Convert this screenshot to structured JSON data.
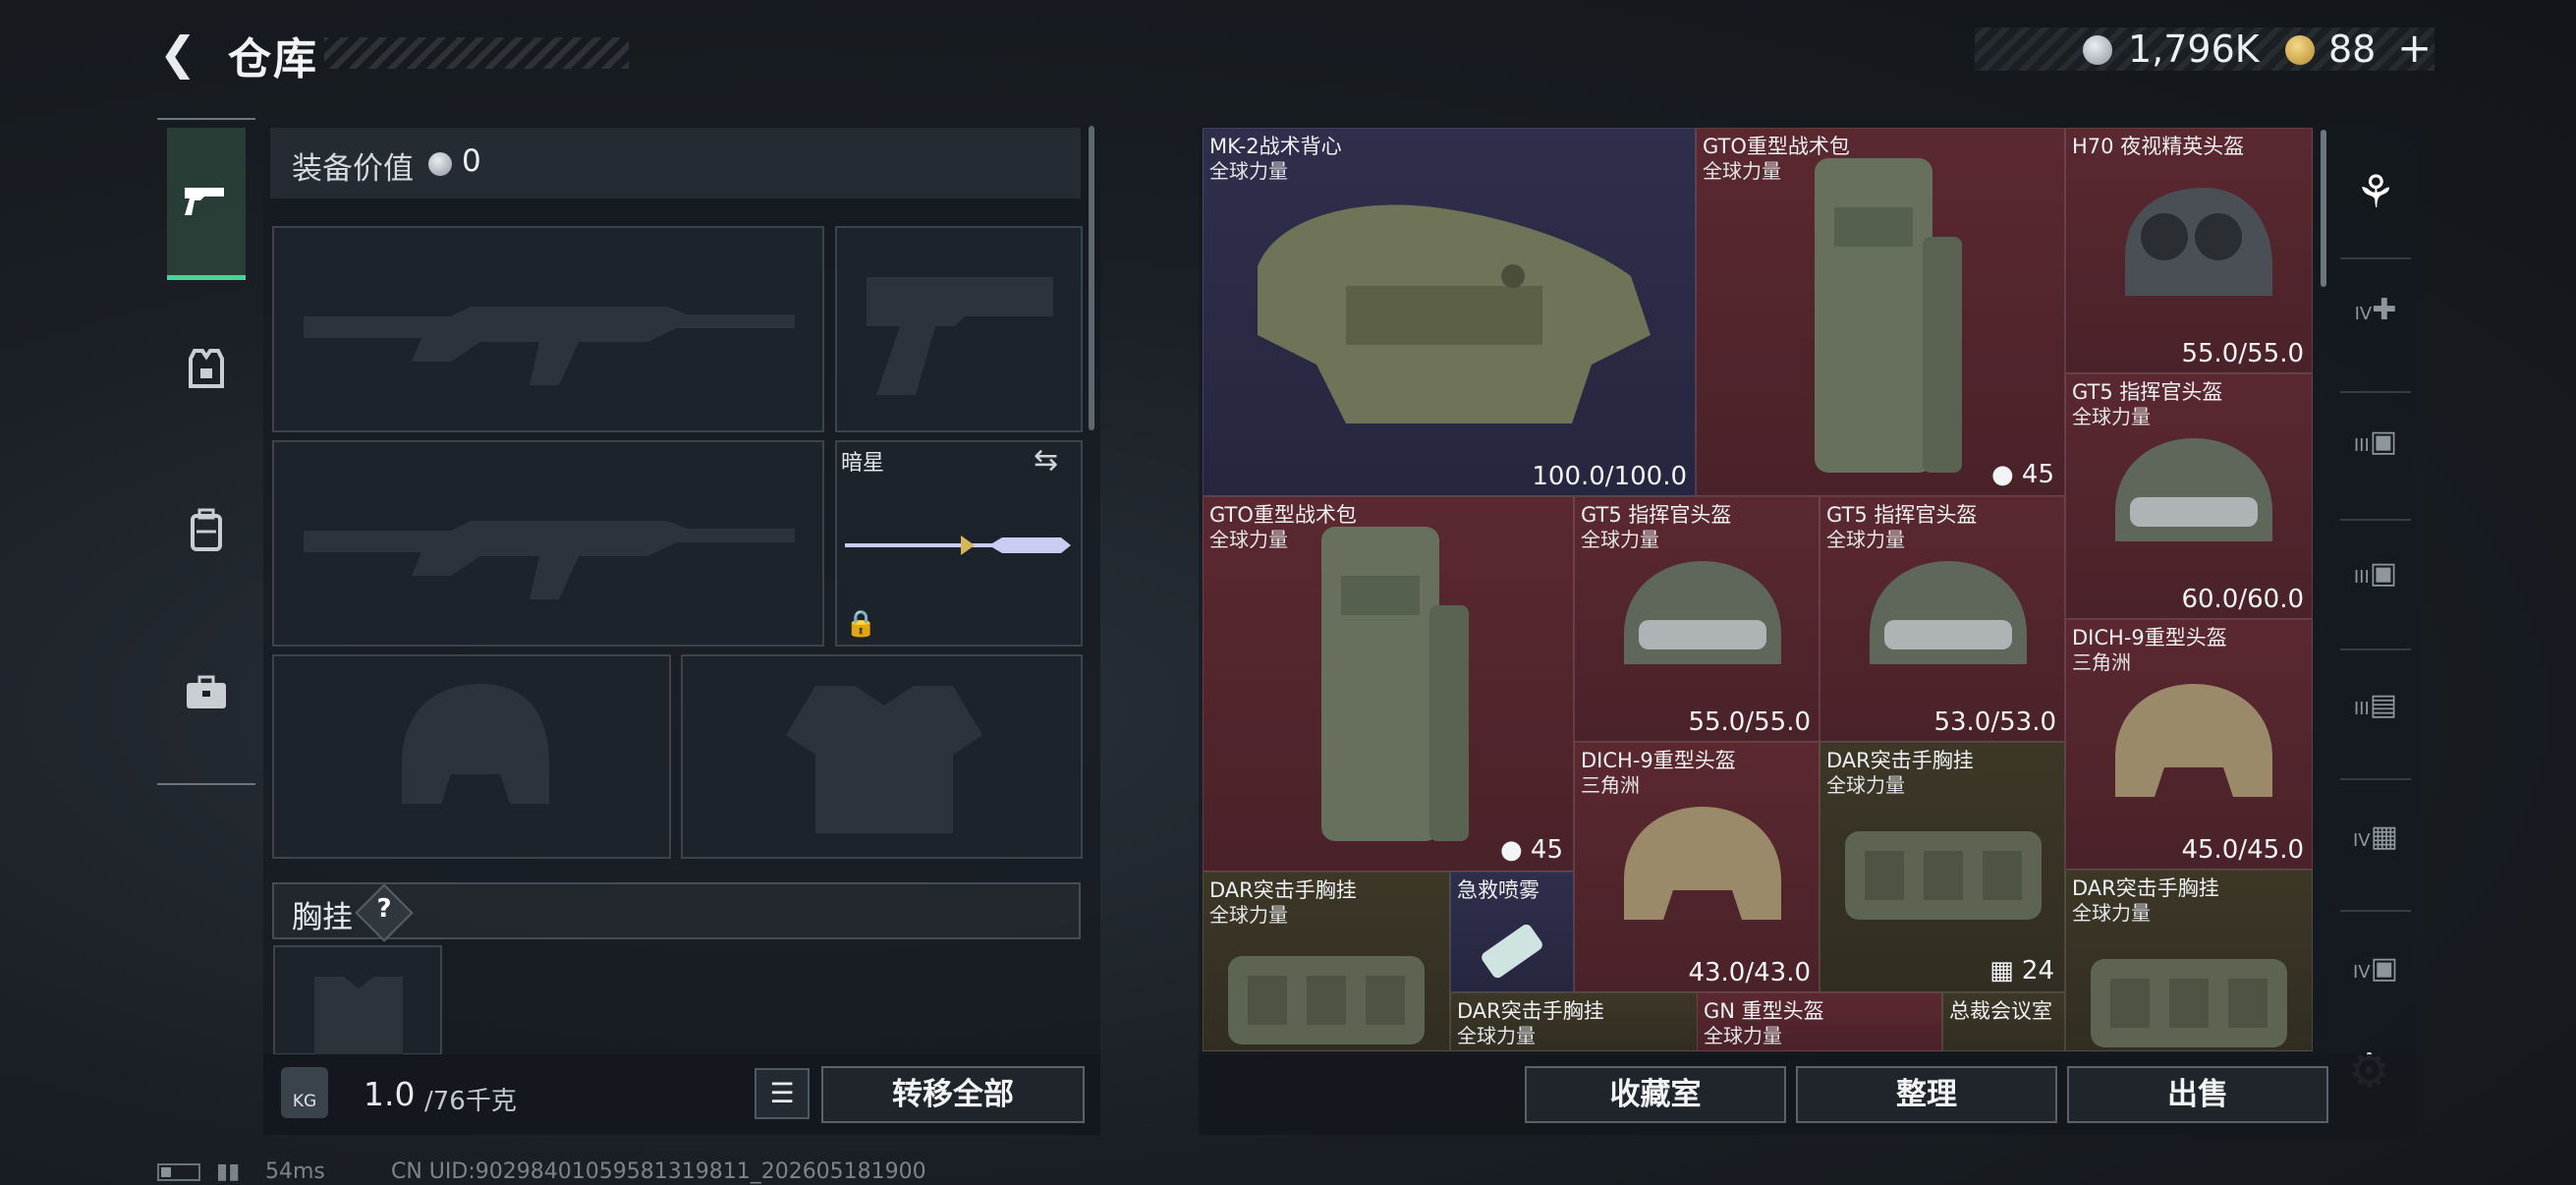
{
  "header": {
    "back_icon": "back-arrow-icon",
    "title": "仓库",
    "currency_silver": "1,796K",
    "currency_gold": "88",
    "currency_gold_plus": "+"
  },
  "sidebar": {
    "tabs": [
      {
        "name": "weapon",
        "icon": "pistol-icon",
        "active": true
      },
      {
        "name": "armor",
        "icon": "armor-icon",
        "active": false
      },
      {
        "name": "backpack",
        "icon": "backpack-icon",
        "active": false
      },
      {
        "name": "case",
        "icon": "briefcase-icon",
        "active": false
      }
    ]
  },
  "loadout": {
    "equip_value_label": "装备价值",
    "equip_value": "0",
    "melee_name": "暗星",
    "chest_label": "胸挂",
    "chest_help": "?"
  },
  "weight": {
    "icon_text": "KG",
    "current": "1.0",
    "max": "/76千克"
  },
  "buttons": {
    "list_icon": "list-icon",
    "transfer_all": "转移全部",
    "collection": "收藏室",
    "sort": "整理",
    "sell": "出售"
  },
  "inventory": [
    {
      "name": "MK-2战术背心",
      "sub": "全球力量",
      "value": "100.0/100.0",
      "rarity": "purple"
    },
    {
      "name": "GTO重型战术包",
      "sub": "全球力量",
      "count": "45",
      "rarity": "red"
    },
    {
      "name": "H70 夜视精英头盔",
      "sub": "",
      "value": "55.0/55.0",
      "rarity": "red"
    },
    {
      "name": "GT5 指挥官头盔",
      "sub": "全球力量",
      "value": "60.0/60.0",
      "rarity": "red"
    },
    {
      "name": "GTO重型战术包",
      "sub": "全球力量",
      "count": "45",
      "rarity": "red"
    },
    {
      "name": "GT5 指挥官头盔",
      "sub": "全球力量",
      "value": "55.0/55.0",
      "rarity": "red"
    },
    {
      "name": "GT5 指挥官头盔",
      "sub": "全球力量",
      "value": "53.0/53.0",
      "rarity": "red"
    },
    {
      "name": "DICH-9重型头盔",
      "sub": "三角洲",
      "value": "45.0/45.0",
      "rarity": "red"
    },
    {
      "name": "DICH-9重型头盔",
      "sub": "三角洲",
      "value": "43.0/43.0",
      "rarity": "red"
    },
    {
      "name": "DAR突击手胸挂",
      "sub": "全球力量",
      "count": "24",
      "rarity": "olive"
    },
    {
      "name": "DAR突击手胸挂",
      "sub": "全球力量",
      "rarity": "olive"
    },
    {
      "name": "急救喷雾",
      "sub": "",
      "rarity": "purple"
    },
    {
      "name": "DAR突击手胸挂",
      "sub": "全球力量",
      "rarity": "olive"
    },
    {
      "name": "DAR突击手胸挂",
      "sub": "全球力量",
      "rarity": "olive"
    },
    {
      "name": "GN 重型头盔",
      "sub": "全球力量",
      "rarity": "red"
    },
    {
      "name": "总裁会议室",
      "sub": "",
      "rarity": "olive"
    }
  ],
  "filters": [
    {
      "icon": "all-items-icon",
      "label": ""
    },
    {
      "icon": "medical-tier-icon",
      "label": "IV"
    },
    {
      "icon": "ammo-tier-icon",
      "label": "III"
    },
    {
      "icon": "ammo-tier-icon",
      "label": "III"
    },
    {
      "icon": "weapon-tier-icon",
      "label": "III"
    },
    {
      "icon": "key-tier-icon",
      "label": "IV"
    },
    {
      "icon": "valuable-tier-icon",
      "label": "IV"
    }
  ],
  "status": {
    "ping": "54ms",
    "uid": "CN UID:9029840105958131981​1_202605181900"
  }
}
